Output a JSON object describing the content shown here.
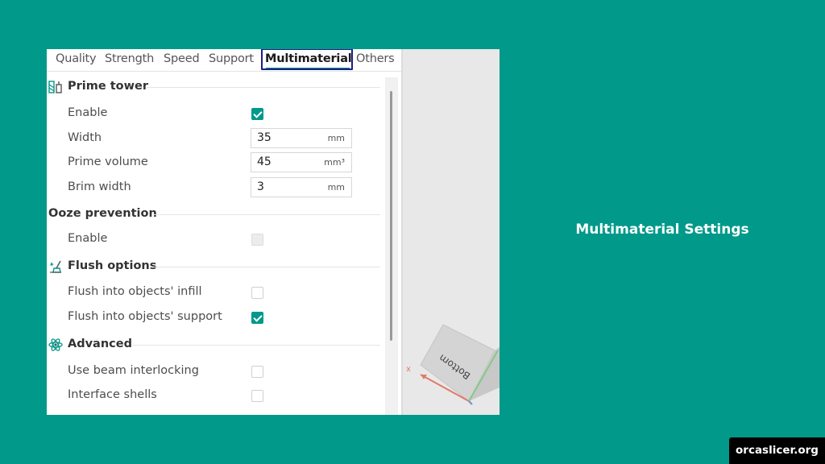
{
  "tabs": [
    {
      "label": "Quality",
      "active": false
    },
    {
      "label": "Strength",
      "active": false
    },
    {
      "label": "Speed",
      "active": false
    },
    {
      "label": "Support",
      "active": false
    },
    {
      "label": "Multimaterial",
      "active": true
    },
    {
      "label": "Others",
      "active": false
    }
  ],
  "prime_tower": {
    "title": "Prime tower",
    "icon": "prime-tower-icon",
    "enable_label": "Enable",
    "enable_checked": true,
    "width_label": "Width",
    "width_value": "35",
    "width_unit": "mm",
    "prime_volume_label": "Prime volume",
    "prime_volume_value": "45",
    "prime_volume_unit": "mm³",
    "brim_width_label": "Brim width",
    "brim_width_value": "3",
    "brim_width_unit": "mm"
  },
  "ooze_prevention": {
    "title": "Ooze prevention",
    "enable_label": "Enable",
    "enable_checked": false,
    "enable_disabled": true
  },
  "flush_options": {
    "title": "Flush options",
    "icon": "flush-brush-icon",
    "infill_label": "Flush into objects' infill",
    "infill_checked": false,
    "support_label": "Flush into objects' support",
    "support_checked": true
  },
  "advanced": {
    "title": "Advanced",
    "icon": "atom-icon",
    "beam_label": "Use beam interlocking",
    "beam_checked": false,
    "shells_label": "Interface shells",
    "shells_checked": false
  },
  "viewport": {
    "cube_label": "Bottom",
    "axis_label": "x"
  },
  "side_title": "Multimaterial Settings",
  "site": "orcaslicer.org",
  "colors": {
    "background": "#00998a",
    "accent": "#00998a",
    "highlight_border": "#1f1e86"
  }
}
